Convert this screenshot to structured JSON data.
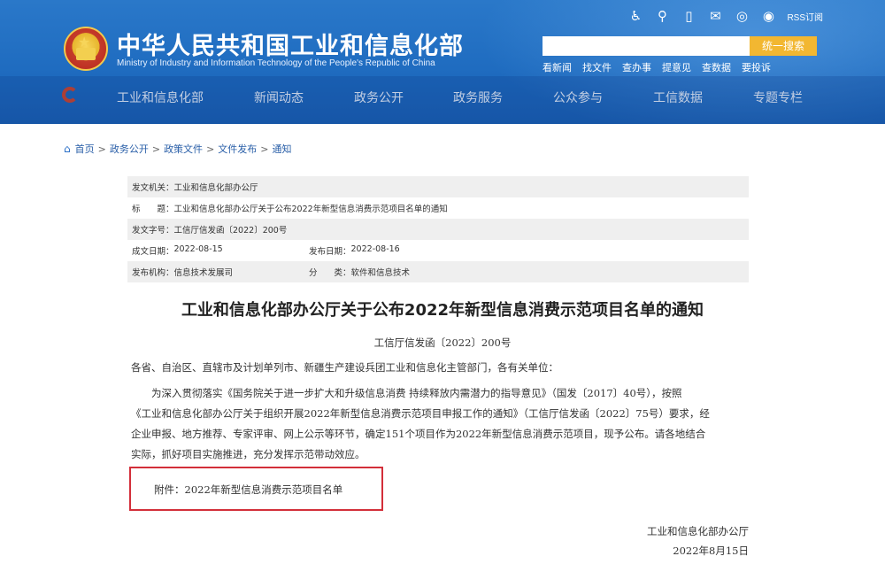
{
  "header": {
    "title": "中华人民共和国工业和信息化部",
    "subtitle": "Ministry of Industry and Information Technology of the People's Republic of China",
    "rss_label": "RSS订阅",
    "search_placeholder": "",
    "search_button": "统一搜索",
    "quick_links": [
      "看新闻",
      "找文件",
      "查办事",
      "提意见",
      "查数据",
      "要投诉"
    ],
    "accent_color": "#1f6cc0",
    "button_color": "#f2b731"
  },
  "nav": {
    "items": [
      "工业和信息化部",
      "新闻动态",
      "政务公开",
      "政务服务",
      "公众参与",
      "工信数据",
      "专题专栏"
    ]
  },
  "breadcrumb": {
    "items": [
      "首页",
      "政务公开",
      "政策文件",
      "文件发布",
      "通知"
    ]
  },
  "meta": {
    "issuer_key": "发文机关：",
    "issuer": "工业和信息化部办公厅",
    "title_key": "标　　题：",
    "title": "工业和信息化部办公厅关于公布2022年新型信息消费示范项目名单的通知",
    "doc_no_key": "发文字号：",
    "doc_no": "工信厅信发函〔2022〕200号",
    "created_key": "成文日期：",
    "created": "2022-08-15",
    "published_key": "发布日期：",
    "published": "2022-08-16",
    "org_key": "发布机构：",
    "org": "信息技术发展司",
    "category_key": "分　　类：",
    "category": "软件和信息技术"
  },
  "article": {
    "title": "工业和信息化部办公厅关于公布2022年新型信息消费示范项目名单的通知",
    "doc_number": "工信厅信发函〔2022〕200号",
    "addressee": "各省、自治区、直辖市及计划单列市、新疆生产建设兵团工业和信息化主管部门，各有关单位：",
    "body_lines": [
      "　　为深入贯彻落实《国务院关于进一步扩大和升级信息消费  持续释放内需潜力的指导意见》（国发〔2017〕40号），按照",
      "《工业和信息化部办公厅关于组织开展2022年新型信息消费示范项目申报工作的通知》（工信厅信发函〔2022〕75号）要求，经",
      "企业申报、地方推荐、专家评审、网上公示等环节，确定151个项目作为2022年新型信息消费示范项目，现予公布。请各地结合",
      "实际，抓好项目实施推进，充分发挥示范带动效应。"
    ],
    "attachment": "附件：2022年新型信息消费示范项目名单",
    "attachment_border_color": "#d32f3a",
    "sign_org": "工业和信息化部办公厅",
    "sign_date": "2022年8月15日"
  }
}
